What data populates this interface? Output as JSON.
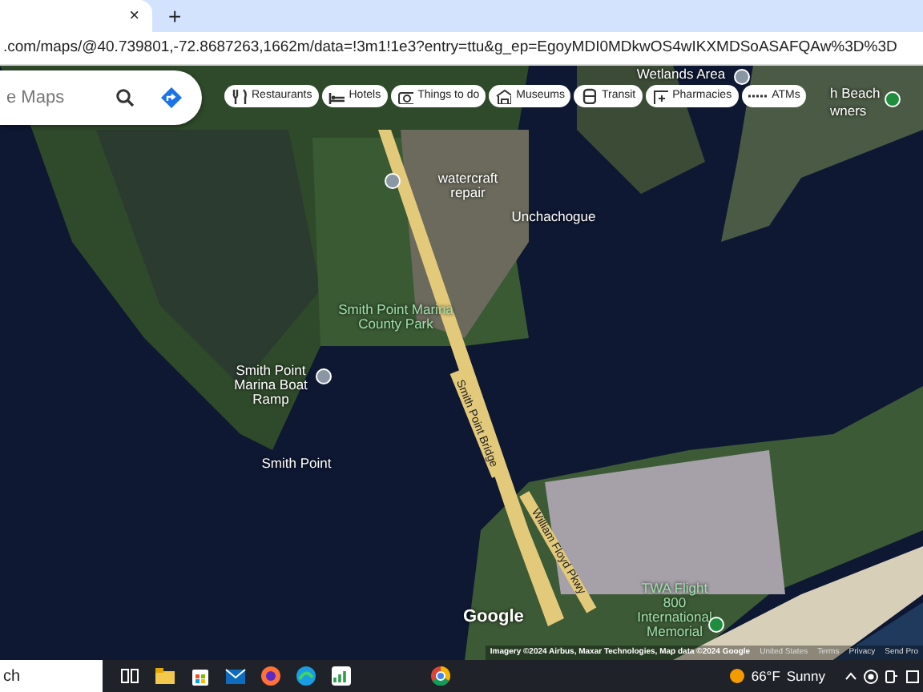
{
  "browser": {
    "tab_close": "×",
    "new_tab": "+",
    "url": ".com/maps/@40.739801,-72.8687263,1662m/data=!3m1!1e3?entry=ttu&g_ep=EgoyMDI0MDkwOS4wIKXMDSoASAFQAw%3D%3D"
  },
  "map": {
    "search": {
      "placeholder": "e Maps"
    },
    "chips": [
      {
        "kind": "restaurant",
        "label": "Restaurants"
      },
      {
        "kind": "hotel",
        "label": "Hotels"
      },
      {
        "kind": "camera",
        "label": "Things to do"
      },
      {
        "kind": "museum",
        "label": "Museums"
      },
      {
        "kind": "transit",
        "label": "Transit"
      },
      {
        "kind": "pharmacy",
        "label": "Pharmacies"
      },
      {
        "kind": "atm",
        "label": "ATMs"
      }
    ],
    "places": [
      {
        "kind": "place",
        "label": "Wetlands Area",
        "pinned": true
      },
      {
        "kind": "place",
        "label": "watercraft repair",
        "pinned": true
      },
      {
        "kind": "place",
        "label": "Unchachogue",
        "pinned": false
      },
      {
        "kind": "park",
        "label": "Smith Point Marina County Park",
        "pinned": false
      },
      {
        "kind": "place",
        "label": "Smith Point Marina Boat Ramp",
        "pinned": true
      },
      {
        "kind": "place",
        "label": "Smith Point",
        "pinned": false
      },
      {
        "kind": "road",
        "label": "Smith Point Bridge",
        "pinned": false
      },
      {
        "kind": "road",
        "label": "William Floyd Pkwy",
        "pinned": false
      },
      {
        "kind": "park",
        "label": "TWA Flight 800 International Memorial",
        "pinned": true
      },
      {
        "kind": "beach",
        "label": "h Beach",
        "pinned": true
      },
      {
        "kind": "beach",
        "label": "wners",
        "pinned": false
      }
    ],
    "logo": "Google",
    "attribution": [
      "Imagery ©2024 Airbus, Maxar Technologies, Map data ©2024 Google",
      "United States",
      "Terms",
      "Privacy",
      "Send Pro"
    ]
  },
  "taskbar": {
    "search": "ch",
    "weather": {
      "temperature": "66°F",
      "condition": "Sunny"
    }
  }
}
